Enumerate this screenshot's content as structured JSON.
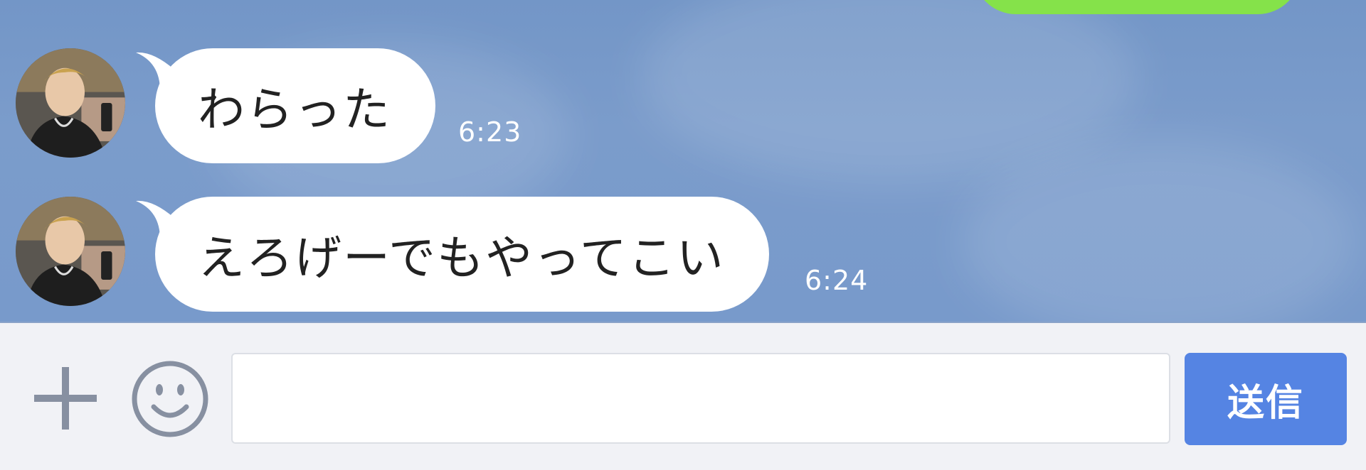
{
  "messages": [
    {
      "text": "わらった",
      "time": "6:23"
    },
    {
      "text": "えろげーでもやってこい",
      "time": "6:24"
    }
  ],
  "input_bar": {
    "placeholder": "",
    "send_label": "送信"
  },
  "colors": {
    "chat_background": "#7b9ccb",
    "sent_bubble": "#85e24a",
    "received_bubble": "#ffffff",
    "send_button": "#5584e3",
    "input_bar_background": "#f1f2f6",
    "icon_gray": "#8790a1"
  },
  "icons": {
    "add": "plus-icon",
    "emoji": "smiley-icon"
  }
}
